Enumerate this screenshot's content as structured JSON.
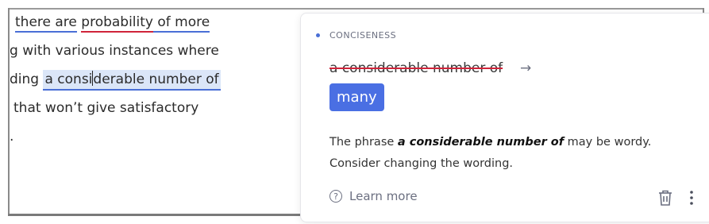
{
  "editor": {
    "line1": {
      "part1": "there are",
      "part2": "probability",
      "part3": " of more"
    },
    "line2": "g with various instances where",
    "line3": {
      "prefix": "ding ",
      "hl_before_caret": "a consi",
      "hl_after_caret": "derable number of"
    },
    "line4": "that won’t give satisfactory",
    "line5": "."
  },
  "card": {
    "category": "CONCISENESS",
    "original": "a considerable number of",
    "arrow": "→",
    "replacement": "many",
    "explanation": {
      "before": "The phrase ",
      "phrase": "a considerable number of",
      "after": " may be wordy. Consider changing the wording."
    },
    "learn_more": "Learn more",
    "help_glyph": "?"
  },
  "icons": {
    "help": "question-circle-icon",
    "delete": "trash-icon",
    "more": "more-vertical-icon"
  },
  "colors": {
    "accent": "#4a6fe3",
    "error_underline": "#d0243a",
    "highlight": "#dbe6f8"
  }
}
